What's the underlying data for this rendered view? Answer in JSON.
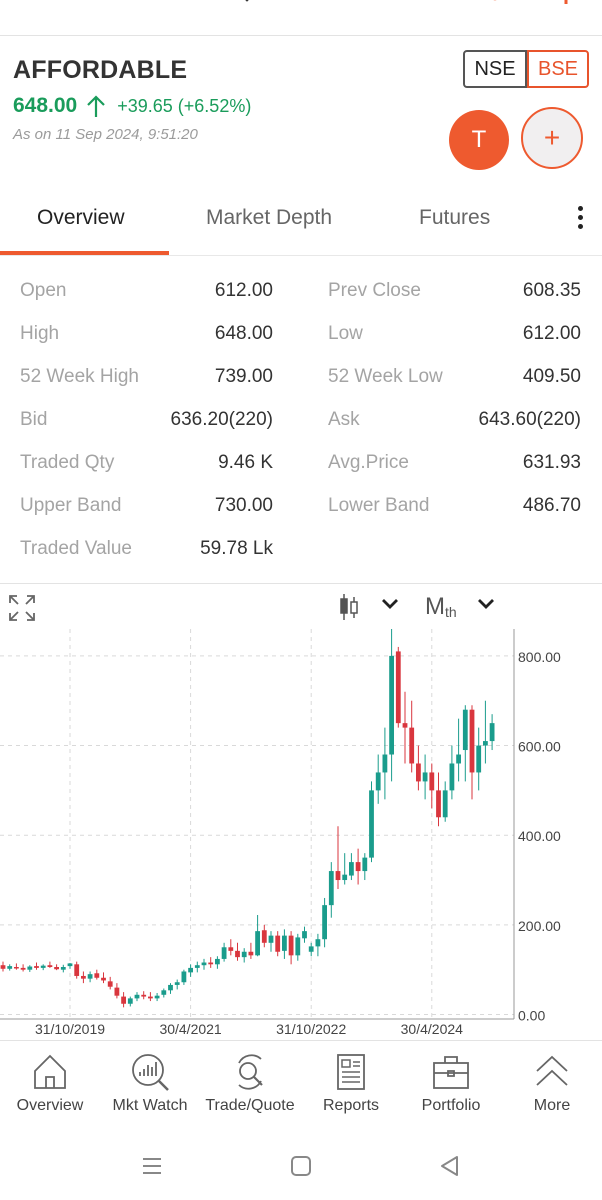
{
  "stock": {
    "symbol": "AFFORDABLE",
    "ltp": "648.00",
    "change": "+39.65 (+6.52%)",
    "as_of": "As on 11 Sep 2024, 9:51:20",
    "exchanges": [
      "NSE",
      "BSE"
    ],
    "selected_exchange": "BSE"
  },
  "actions": {
    "trade_label": "T",
    "add_label": "+"
  },
  "tabs": [
    "Overview",
    "Market Depth",
    "Futures"
  ],
  "active_tab": "Overview",
  "stats": [
    {
      "l1": "Open",
      "v1": "612.00",
      "l2": "Prev Close",
      "v2": "608.35"
    },
    {
      "l1": "High",
      "v1": "648.00",
      "l2": "Low",
      "v2": "612.00"
    },
    {
      "l1": "52 Week High",
      "v1": "739.00",
      "l2": "52 Week Low",
      "v2": "409.50"
    },
    {
      "l1": "Bid",
      "v1": "636.20(220)",
      "l2": "Ask",
      "v2": "643.60(220)"
    },
    {
      "l1": "Traded Qty",
      "v1": "9.46 K",
      "l2": "Avg.Price",
      "v2": "631.93"
    },
    {
      "l1": "Upper Band",
      "v1": "730.00",
      "l2": "Lower Band",
      "v2": "486.70"
    },
    {
      "l1": "Traded Value",
      "v1": "59.78 Lk",
      "l2": "",
      "v2": ""
    }
  ],
  "chart_tools": {
    "chart_type_icon": "candlestick-icon",
    "interval": "M",
    "interval_sub": "th"
  },
  "chart_data": {
    "type": "candlestick",
    "y_ticks": [
      "800.00",
      "600.00",
      "400.00",
      "200.00",
      "0.00"
    ],
    "y_tick_values": [
      800,
      600,
      400,
      200,
      0
    ],
    "ylim": [
      -10,
      860
    ],
    "x_ticks": [
      "31/10/2019",
      "30/4/2021",
      "31/10/2022",
      "30/4/2024"
    ],
    "x_tick_index": [
      10,
      28,
      46,
      64
    ],
    "grid": true,
    "colors": {
      "up": "#1a9c8c",
      "down": "#d9363e"
    },
    "candles": [
      [
        110,
        118,
        96,
        102
      ],
      [
        102,
        112,
        98,
        108
      ],
      [
        106,
        114,
        100,
        104
      ],
      [
        104,
        112,
        96,
        100
      ],
      [
        100,
        110,
        95,
        107
      ],
      [
        108,
        116,
        100,
        104
      ],
      [
        104,
        112,
        99,
        109
      ],
      [
        110,
        118,
        104,
        106
      ],
      [
        106,
        112,
        99,
        101
      ],
      [
        100,
        111,
        94,
        106
      ],
      [
        108,
        115,
        102,
        114
      ],
      [
        112,
        118,
        80,
        86
      ],
      [
        86,
        96,
        70,
        80
      ],
      [
        80,
        96,
        72,
        90
      ],
      [
        92,
        100,
        78,
        82
      ],
      [
        82,
        94,
        70,
        76
      ],
      [
        74,
        84,
        56,
        62
      ],
      [
        60,
        70,
        36,
        42
      ],
      [
        40,
        50,
        16,
        24
      ],
      [
        24,
        40,
        18,
        36
      ],
      [
        36,
        50,
        30,
        44
      ],
      [
        44,
        52,
        34,
        40
      ],
      [
        40,
        50,
        30,
        36
      ],
      [
        36,
        48,
        30,
        42
      ],
      [
        44,
        58,
        38,
        54
      ],
      [
        54,
        70,
        46,
        66
      ],
      [
        66,
        78,
        56,
        72
      ],
      [
        72,
        100,
        66,
        96
      ],
      [
        94,
        112,
        84,
        104
      ],
      [
        104,
        118,
        94,
        110
      ],
      [
        110,
        124,
        100,
        116
      ],
      [
        116,
        128,
        104,
        112
      ],
      [
        112,
        130,
        102,
        124
      ],
      [
        124,
        160,
        118,
        150
      ],
      [
        150,
        168,
        132,
        142
      ],
      [
        142,
        160,
        120,
        128
      ],
      [
        128,
        148,
        116,
        140
      ],
      [
        140,
        160,
        124,
        132
      ],
      [
        132,
        222,
        130,
        186
      ],
      [
        188,
        200,
        150,
        160
      ],
      [
        160,
        186,
        140,
        176
      ],
      [
        176,
        186,
        130,
        140
      ],
      [
        142,
        190,
        124,
        176
      ],
      [
        176,
        186,
        112,
        132
      ],
      [
        132,
        180,
        120,
        172
      ],
      [
        170,
        196,
        160,
        186
      ],
      [
        140,
        160,
        130,
        152
      ],
      [
        152,
        180,
        130,
        168
      ],
      [
        168,
        260,
        150,
        244
      ],
      [
        244,
        340,
        216,
        320
      ],
      [
        320,
        420,
        280,
        300
      ],
      [
        300,
        360,
        290,
        312
      ],
      [
        310,
        360,
        300,
        340
      ],
      [
        340,
        370,
        290,
        320
      ],
      [
        320,
        360,
        300,
        350
      ],
      [
        350,
        520,
        340,
        500
      ],
      [
        500,
        580,
        470,
        540
      ],
      [
        540,
        640,
        480,
        580
      ],
      [
        580,
        860,
        520,
        800
      ],
      [
        810,
        820,
        640,
        650
      ],
      [
        650,
        720,
        560,
        640
      ],
      [
        640,
        700,
        540,
        560
      ],
      [
        560,
        600,
        500,
        520
      ],
      [
        520,
        580,
        480,
        540
      ],
      [
        540,
        560,
        460,
        500
      ],
      [
        500,
        540,
        420,
        440
      ],
      [
        440,
        520,
        430,
        500
      ],
      [
        500,
        600,
        480,
        560
      ],
      [
        560,
        660,
        520,
        580
      ],
      [
        590,
        690,
        520,
        680
      ],
      [
        680,
        690,
        480,
        540
      ],
      [
        540,
        640,
        500,
        600
      ],
      [
        600,
        700,
        560,
        610
      ],
      [
        610,
        670,
        590,
        650
      ]
    ]
  },
  "nav": [
    {
      "label": "Overview",
      "icon": "home-icon"
    },
    {
      "label": "Mkt Watch",
      "icon": "market-watch-icon"
    },
    {
      "label": "Trade/Quote",
      "icon": "trade-quote-icon"
    },
    {
      "label": "Reports",
      "icon": "reports-icon"
    },
    {
      "label": "Portfolio",
      "icon": "portfolio-icon"
    },
    {
      "label": "More",
      "icon": "more-icon"
    }
  ],
  "system_nav": [
    "recents-icon",
    "home-button-icon",
    "back-icon"
  ]
}
